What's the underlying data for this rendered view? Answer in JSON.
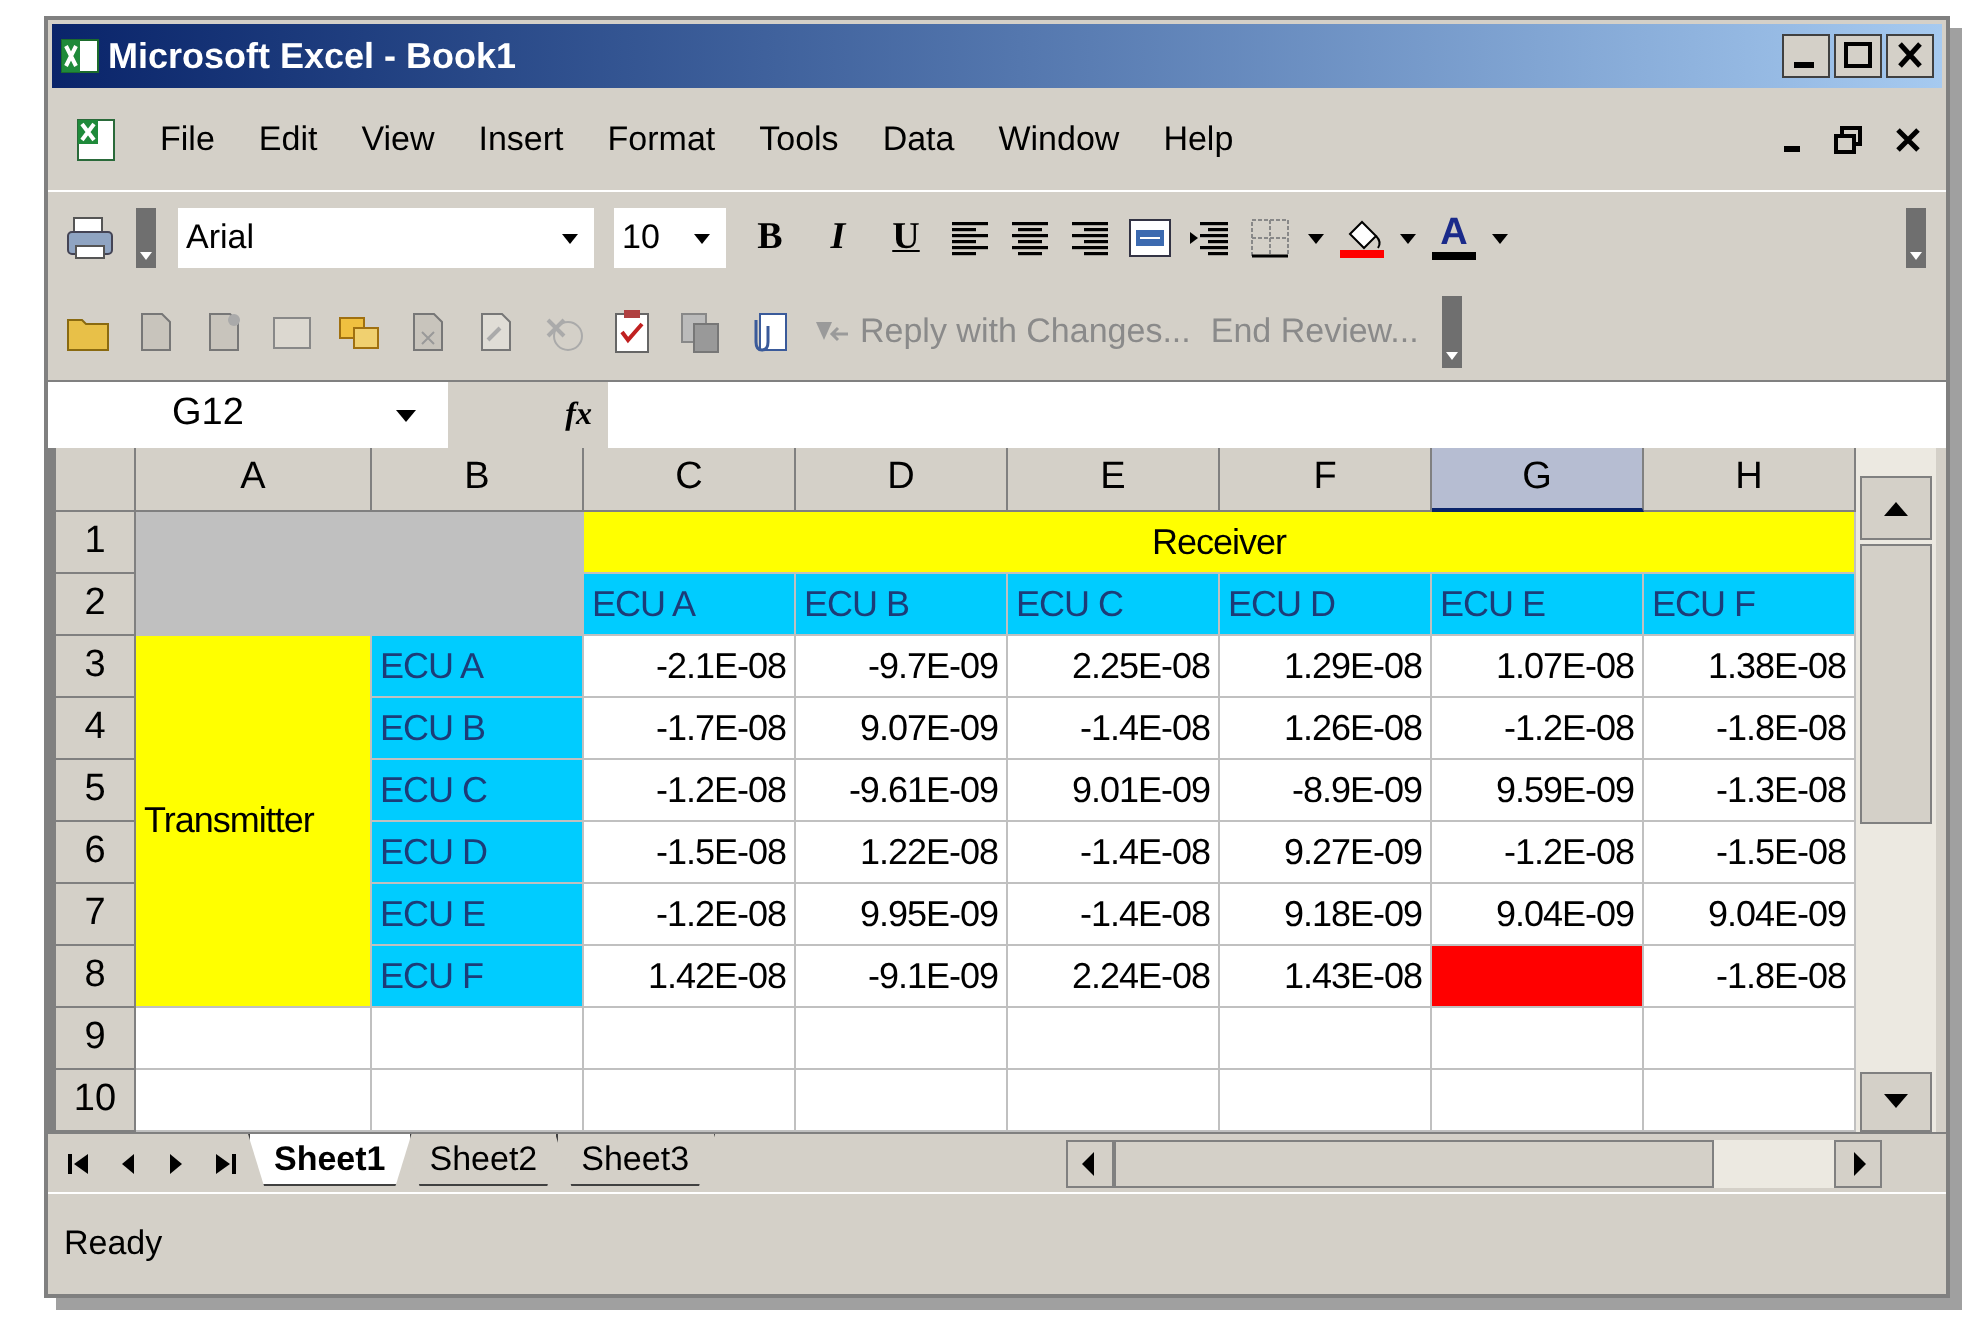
{
  "window": {
    "title": "Microsoft Excel - Book1"
  },
  "menu": [
    "File",
    "Edit",
    "View",
    "Insert",
    "Format",
    "Tools",
    "Data",
    "Window",
    "Help"
  ],
  "formatting_toolbar": {
    "font": "Arial",
    "size": "10",
    "bold": "B",
    "italic": "I",
    "underline": "U",
    "font_color_label": "A"
  },
  "reviewing_toolbar": [
    {
      "label": "Reply with Changes...",
      "disabled": true
    },
    {
      "label": "End Review...",
      "disabled": true
    }
  ],
  "name_box": "G12",
  "formula_label": "fx",
  "columns": [
    {
      "label": "A",
      "selected": false
    },
    {
      "label": "B",
      "selected": false
    },
    {
      "label": "C",
      "selected": false
    },
    {
      "label": "D",
      "selected": false
    },
    {
      "label": "E",
      "selected": false
    },
    {
      "label": "F",
      "selected": false
    },
    {
      "label": "G",
      "selected": true
    },
    {
      "label": "H",
      "selected": false
    }
  ],
  "rows": [
    {
      "header": "1",
      "cells": [
        {
          "kind": "fill",
          "color": "#c0c0c0"
        },
        {
          "kind": "merged"
        },
        {
          "kind": "title",
          "text": "Receiver",
          "color": "#ffff00"
        },
        {
          "kind": "merged"
        },
        {
          "kind": "merged"
        },
        {
          "kind": "merged"
        },
        {
          "kind": "merged"
        },
        {
          "kind": "merged"
        }
      ]
    },
    {
      "header": "2",
      "cells": [
        {
          "kind": "merged"
        },
        {
          "kind": "merged"
        },
        {
          "kind": "label",
          "text": "ECU A",
          "color": "#00ccff"
        },
        {
          "kind": "label",
          "text": "ECU B",
          "color": "#00ccff"
        },
        {
          "kind": "label",
          "text": "ECU C",
          "color": "#00ccff"
        },
        {
          "kind": "label",
          "text": "ECU D",
          "color": "#00ccff"
        },
        {
          "kind": "label",
          "text": "ECU E",
          "color": "#00ccff"
        },
        {
          "kind": "label",
          "text": "ECU F",
          "color": "#00ccff"
        }
      ]
    },
    {
      "header": "3",
      "cells": [
        {
          "kind": "text",
          "text": "Transmitter",
          "color": "#ffff00"
        },
        {
          "kind": "label",
          "text": "ECU A",
          "color": "#00ccff"
        },
        {
          "kind": "number",
          "text": "-2.1E-08"
        },
        {
          "kind": "number",
          "text": "-9.7E-09"
        },
        {
          "kind": "number",
          "text": "2.25E-08"
        },
        {
          "kind": "number",
          "text": "1.29E-08"
        },
        {
          "kind": "number",
          "text": "1.07E-08"
        },
        {
          "kind": "number",
          "text": "1.38E-08"
        }
      ]
    },
    {
      "header": "4",
      "cells": [
        {
          "kind": "merged"
        },
        {
          "kind": "label",
          "text": "ECU B",
          "color": "#00ccff"
        },
        {
          "kind": "number",
          "text": "-1.7E-08"
        },
        {
          "kind": "number",
          "text": "9.07E-09"
        },
        {
          "kind": "number",
          "text": "-1.4E-08"
        },
        {
          "kind": "number",
          "text": "1.26E-08"
        },
        {
          "kind": "number",
          "text": "-1.2E-08"
        },
        {
          "kind": "number",
          "text": "-1.8E-08"
        }
      ]
    },
    {
      "header": "5",
      "cells": [
        {
          "kind": "merged"
        },
        {
          "kind": "label",
          "text": "ECU C",
          "color": "#00ccff"
        },
        {
          "kind": "number",
          "text": "-1.2E-08"
        },
        {
          "kind": "number",
          "text": "-9.61E-09"
        },
        {
          "kind": "number",
          "text": "9.01E-09"
        },
        {
          "kind": "number",
          "text": "-8.9E-09"
        },
        {
          "kind": "number",
          "text": "9.59E-09"
        },
        {
          "kind": "number",
          "text": "-1.3E-08"
        }
      ]
    },
    {
      "header": "6",
      "cells": [
        {
          "kind": "merged"
        },
        {
          "kind": "label",
          "text": "ECU D",
          "color": "#00ccff"
        },
        {
          "kind": "number",
          "text": "-1.5E-08"
        },
        {
          "kind": "number",
          "text": "1.22E-08"
        },
        {
          "kind": "number",
          "text": "-1.4E-08"
        },
        {
          "kind": "number",
          "text": "9.27E-09"
        },
        {
          "kind": "number",
          "text": "-1.2E-08"
        },
        {
          "kind": "number",
          "text": "-1.5E-08"
        }
      ]
    },
    {
      "header": "7",
      "cells": [
        {
          "kind": "merged"
        },
        {
          "kind": "label",
          "text": "ECU E",
          "color": "#00ccff"
        },
        {
          "kind": "number",
          "text": "-1.2E-08"
        },
        {
          "kind": "number",
          "text": "9.95E-09"
        },
        {
          "kind": "number",
          "text": "-1.4E-08"
        },
        {
          "kind": "number",
          "text": "9.18E-09"
        },
        {
          "kind": "number",
          "text": "9.04E-09"
        },
        {
          "kind": "number",
          "text": "9.04E-09"
        }
      ]
    },
    {
      "header": "8",
      "cells": [
        {
          "kind": "merged"
        },
        {
          "kind": "label",
          "text": "ECU F",
          "color": "#00ccff"
        },
        {
          "kind": "number",
          "text": "1.42E-08"
        },
        {
          "kind": "number",
          "text": "-9.1E-09"
        },
        {
          "kind": "number",
          "text": "2.24E-08"
        },
        {
          "kind": "number",
          "text": "1.43E-08"
        },
        {
          "kind": "fill",
          "color": "#ff0000"
        },
        {
          "kind": "number",
          "text": "-1.8E-08"
        }
      ]
    },
    {
      "header": "9"
    },
    {
      "header": "10"
    }
  ],
  "sheet_tabs": [
    {
      "label": "Sheet1",
      "selected": true
    },
    {
      "label": "Sheet2",
      "selected": false
    },
    {
      "label": "Sheet3",
      "selected": false
    }
  ],
  "status_bar": "Ready"
}
